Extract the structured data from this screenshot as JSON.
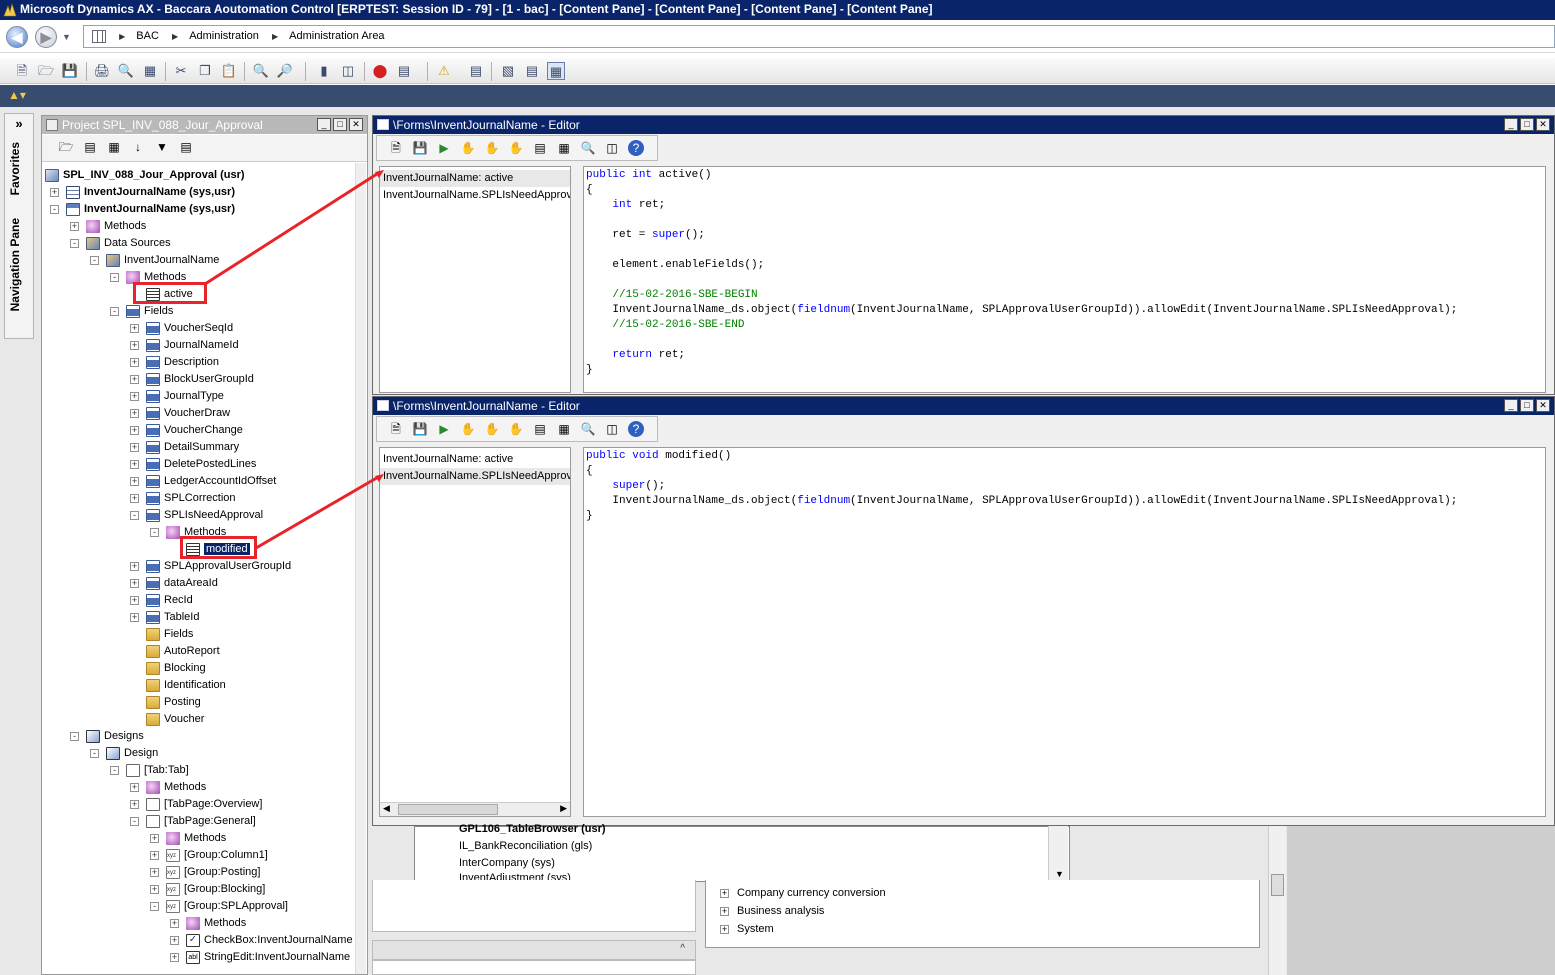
{
  "window": {
    "title": "Microsoft Dynamics AX - Baccara Aoutomation Control [ERPTEST: Session ID - 79] - [1 - bac] - [Content Pane] - [Content Pane] - [Content Pane] - [Content Pane]"
  },
  "address": {
    "crumbs": [
      "BAC",
      "Administration",
      "Administration Area"
    ]
  },
  "favorites": {
    "chevron": "»",
    "favorites_label": "Favorites",
    "navpane_label": "Navigation Pane"
  },
  "project": {
    "title": "Project SPL_INV_088_Jour_Approval",
    "tree": [
      {
        "label": "SPL_INV_088_Jour_Approval (usr)"
      },
      {
        "label": "InventJournalName (sys,usr)"
      },
      {
        "label": "InventJournalName (sys,usr)"
      },
      {
        "label": "Methods"
      },
      {
        "label": "Data Sources"
      },
      {
        "label": "InventJournalName"
      },
      {
        "label": "Methods"
      },
      {
        "label": "active"
      },
      {
        "label": "Fields"
      },
      {
        "label": "VoucherSeqId"
      },
      {
        "label": "JournalNameId"
      },
      {
        "label": "Description"
      },
      {
        "label": "BlockUserGroupId"
      },
      {
        "label": "JournalType"
      },
      {
        "label": "VoucherDraw"
      },
      {
        "label": "VoucherChange"
      },
      {
        "label": "DetailSummary"
      },
      {
        "label": "DeletePostedLines"
      },
      {
        "label": "LedgerAccountIdOffset"
      },
      {
        "label": "SPLCorrection"
      },
      {
        "label": "SPLIsNeedApproval"
      },
      {
        "label": "Methods"
      },
      {
        "label": "modified"
      },
      {
        "label": "SPLApprovalUserGroupId"
      },
      {
        "label": "dataAreaId"
      },
      {
        "label": "RecId"
      },
      {
        "label": "TableId"
      },
      {
        "label": "Fields"
      },
      {
        "label": "AutoReport"
      },
      {
        "label": "Blocking"
      },
      {
        "label": "Identification"
      },
      {
        "label": "Posting"
      },
      {
        "label": "Voucher"
      },
      {
        "label": "Designs"
      },
      {
        "label": "Design"
      },
      {
        "label": "[Tab:Tab]"
      },
      {
        "label": "Methods"
      },
      {
        "label": "[TabPage:Overview]"
      },
      {
        "label": "[TabPage:General]"
      },
      {
        "label": "Methods"
      },
      {
        "label": "[Group:Column1]"
      },
      {
        "label": "[Group:Posting]"
      },
      {
        "label": "[Group:Blocking]"
      },
      {
        "label": "[Group:SPLApproval]"
      },
      {
        "label": "Methods"
      },
      {
        "label": "CheckBox:InventJournalName"
      },
      {
        "label": "StringEdit:InventJournalName"
      }
    ]
  },
  "editor1": {
    "title": "\\Forms\\InventJournalName - Editor",
    "methods": [
      "InventJournalName: active",
      "InventJournalName.SPLIsNeedApproval"
    ],
    "code": [
      {
        "text": "public int active()"
      },
      {
        "text": "{"
      },
      {
        "text": "    int ret;"
      },
      {
        "text": ""
      },
      {
        "text": "    ret = super();"
      },
      {
        "text": ""
      },
      {
        "text": "    element.enableFields();"
      },
      {
        "text": ""
      },
      {
        "text": "    //15-02-2016-SBE-BEGIN"
      },
      {
        "text": "    InventJournalName_ds.object(fieldnum(InventJournalName, SPLApprovalUserGroupId)).allowEdit(InventJournalName.SPLIsNeedApproval);"
      },
      {
        "text": "    //15-02-2016-SBE-END"
      },
      {
        "text": ""
      },
      {
        "text": "    return ret;"
      },
      {
        "text": "}"
      }
    ]
  },
  "editor2": {
    "title": "\\Forms\\InventJournalName - Editor",
    "methods": [
      "InventJournalName: active",
      "InventJournalName.SPLIsNeedApproval"
    ],
    "code": [
      {
        "text": "public void modified()"
      },
      {
        "text": "{"
      },
      {
        "text": "    super();"
      },
      {
        "text": "    InventJournalName_ds.object(fieldnum(InventJournalName, SPLApprovalUserGroupId)).allowEdit(InventJournalName.SPLIsNeedApproval);"
      },
      {
        "text": "}"
      }
    ]
  },
  "aot_list": [
    "GPL106_TableBrowser (usr)",
    "IL_BankReconciliation (gls)",
    "InterCompany (sys)",
    "InventAdjustment (sys)"
  ],
  "nav_tree": [
    "Company currency conversion",
    "Business analysis",
    "System"
  ],
  "colors": {
    "titlebar": "#0a246a",
    "highlight_box": "#e8232a",
    "comment": "#008000",
    "keyword": "#0000ff"
  }
}
